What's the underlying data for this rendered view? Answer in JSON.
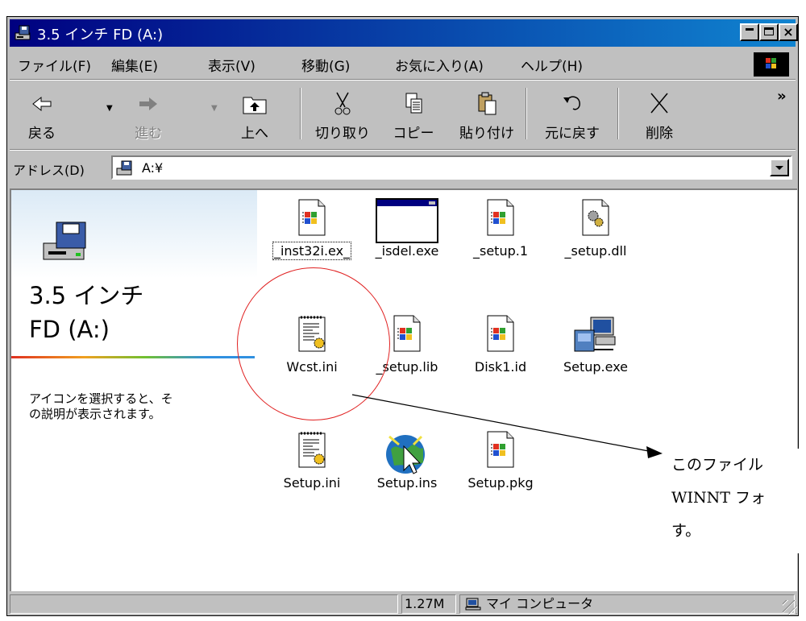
{
  "window": {
    "title": "3.5 インチ FD (A:)",
    "controls": [
      "_",
      "□",
      "×"
    ]
  },
  "menu": [
    "ファイル(F)",
    "編集(E)",
    "表示(V)",
    "移動(G)",
    "お気に入り(A)",
    "ヘルプ(H)"
  ],
  "toolbar": {
    "back": "戻る",
    "forward": "進む",
    "up": "上へ",
    "cut": "切り取り",
    "copy": "コピー",
    "paste": "貼り付け",
    "undo": "元に戻す",
    "delete": "削除",
    "more": "»"
  },
  "address": {
    "label": "アドレス(D)",
    "value": "A:¥"
  },
  "left_pane": {
    "title_line1": "3.5 インチ",
    "title_line2": "FD (A:)",
    "desc_line1": "アイコンを選択すると、そ",
    "desc_line2": "の説明が表示されます。"
  },
  "files": [
    {
      "name": "_inst32i.ex_",
      "icon": "setup-package-icon"
    },
    {
      "name": "_isdel.exe",
      "icon": "window-app-icon"
    },
    {
      "name": "_setup.1",
      "icon": "setup-package-icon"
    },
    {
      "name": "_setup.dll",
      "icon": "dll-gear-icon"
    },
    {
      "name": "Wcst.ini",
      "icon": "ini-settings-icon"
    },
    {
      "name": "_setup.lib",
      "icon": "setup-package-icon"
    },
    {
      "name": "Disk1.id",
      "icon": "setup-package-icon"
    },
    {
      "name": "Setup.exe",
      "icon": "setup-computer-icon"
    },
    {
      "name": "Setup.ini",
      "icon": "ini-settings-icon"
    },
    {
      "name": "Setup.ins",
      "icon": "install-script-globe-icon"
    },
    {
      "name": "Setup.pkg",
      "icon": "setup-package-icon"
    }
  ],
  "status": {
    "size": "1.27M",
    "zone": "マイ コンピュータ"
  },
  "annotation": {
    "line1": "このファイル",
    "line2": "WINNT フォ",
    "line3": "す。",
    "circle_color": "#e02020"
  }
}
